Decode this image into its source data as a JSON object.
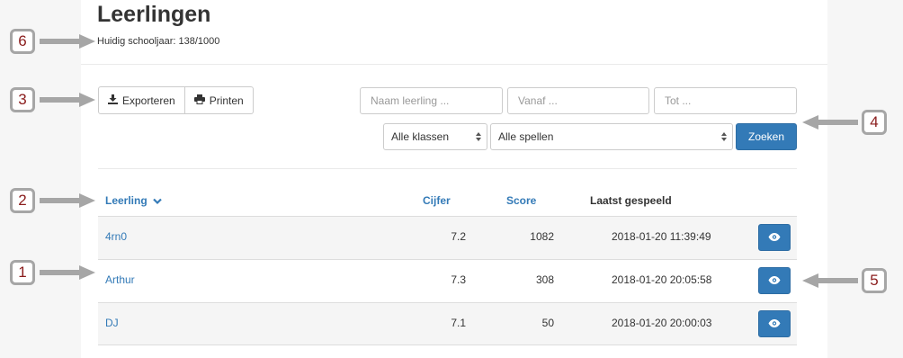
{
  "page": {
    "title": "Leerlingen",
    "subtitle": "Huidig schooljaar: 138/1000"
  },
  "toolbar": {
    "export_label": "Exporteren",
    "print_label": "Printen"
  },
  "filters": {
    "name_placeholder": "Naam leerling ...",
    "from_placeholder": "Vanaf ...",
    "to_placeholder": "Tot ...",
    "class_select": "Alle klassen",
    "game_select": "Alle spellen",
    "search_label": "Zoeken"
  },
  "table": {
    "headers": {
      "student": "Leerling",
      "grade": "Cijfer",
      "score": "Score",
      "last_played": "Laatst gespeeld"
    },
    "rows": [
      {
        "name": "4rn0",
        "grade": "7.2",
        "score": "1082",
        "last_played": "2018-01-20 11:39:49"
      },
      {
        "name": "Arthur",
        "grade": "7.3",
        "score": "308",
        "last_played": "2018-01-20 20:05:58"
      },
      {
        "name": "DJ",
        "grade": "7.1",
        "score": "50",
        "last_played": "2018-01-20 20:00:03"
      }
    ]
  },
  "callouts": [
    "1",
    "2",
    "3",
    "4",
    "5",
    "6"
  ],
  "colors": {
    "primary": "#337ab7",
    "callout_text": "#8a1c1c",
    "callout_border": "#a6a6a6"
  },
  "icons": {
    "export": "download-icon",
    "print": "printer-icon",
    "sort": "chevron-down-icon",
    "view": "eye-icon",
    "select": "select-arrows-icon"
  }
}
